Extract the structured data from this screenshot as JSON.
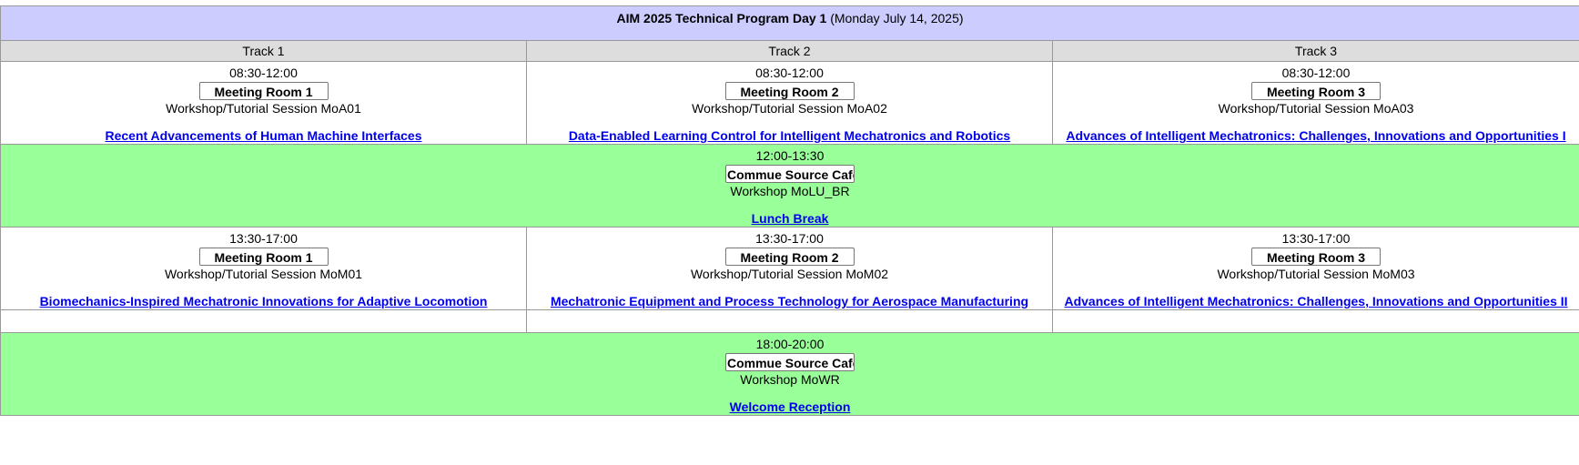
{
  "header": {
    "title_bold": "AIM 2025 Technical Program Day 1",
    "title_rest": " (Monday July 14, 2025)"
  },
  "tracks": [
    "Track 1",
    "Track 2",
    "Track 3"
  ],
  "morning": [
    {
      "time": "08:30-12:00",
      "room": "Meeting Room 1",
      "session": "Workshop/Tutorial Session MoA01",
      "title": "Recent Advancements of Human Machine Interfaces"
    },
    {
      "time": "08:30-12:00",
      "room": "Meeting Room 2",
      "session": "Workshop/Tutorial Session MoA02",
      "title": "Data-Enabled Learning Control for Intelligent Mechatronics and Robotics"
    },
    {
      "time": "08:30-12:00",
      "room": "Meeting Room 3",
      "session": "Workshop/Tutorial Session MoA03",
      "title": "Advances of Intelligent Mechatronics: Challenges, Innovations and Opportunities  I"
    }
  ],
  "lunch": {
    "time": "12:00-13:30",
    "room": "Commue Source Cafe",
    "session": "Workshop MoLU_BR",
    "title": "Lunch Break"
  },
  "afternoon": [
    {
      "time": "13:30-17:00",
      "room": "Meeting Room 1",
      "session": "Workshop/Tutorial Session MoM01",
      "title": "Biomechanics-Inspired Mechatronic Innovations for Adaptive Locomotion"
    },
    {
      "time": "13:30-17:00",
      "room": "Meeting Room 2",
      "session": "Workshop/Tutorial Session MoM02",
      "title": "Mechatronic Equipment and Process Technology for Aerospace Manufacturing"
    },
    {
      "time": "13:30-17:00",
      "room": "Meeting Room 3",
      "session": "Workshop/Tutorial Session MoM03",
      "title": "Advances of Intelligent Mechatronics: Challenges, Innovations and Opportunities II"
    }
  ],
  "reception": {
    "time": "18:00-20:00",
    "room": "Commue Source Cafe",
    "session": "Workshop MoWR",
    "title": "Welcome Reception"
  },
  "colors": {
    "header_bg": "#ccccff",
    "track_bg": "#dddddd",
    "break_bg": "#99ff99",
    "link": "#0000ee"
  }
}
